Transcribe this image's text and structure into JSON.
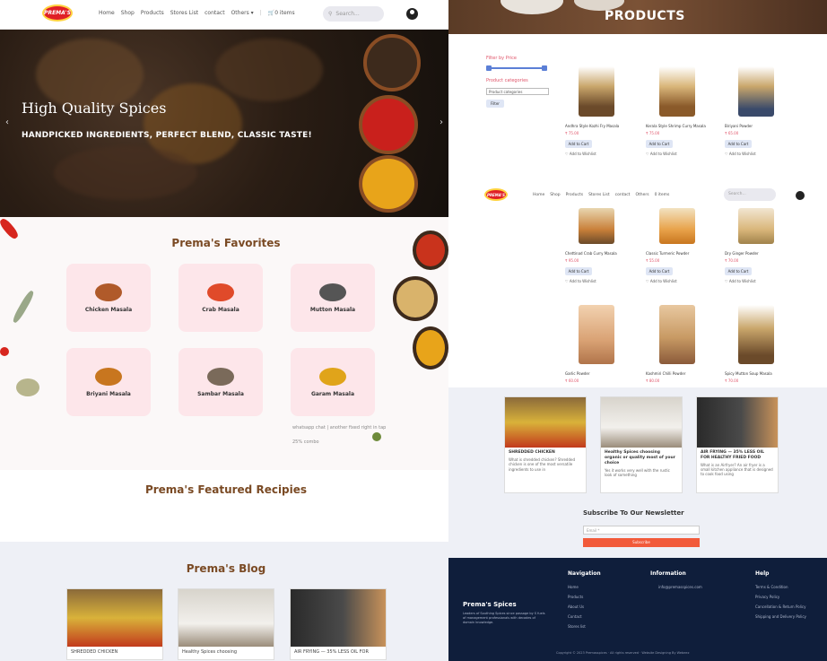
{
  "left": {
    "logo_text": "PREMA'S",
    "nav": {
      "items": [
        "Home",
        "Shop",
        "Products",
        "Stores List",
        "contact",
        "Others"
      ],
      "others_caret": "▾",
      "cart_label": "0 items",
      "search_placeholder": "Search..."
    },
    "hero": {
      "title": "High Quality Spices",
      "subtitle": "HANDPICKED INGREDIENTS, PERFECT BLEND, CLASSIC TASTE!"
    },
    "favorites": {
      "title": "Prema's Favorites",
      "items": [
        "Chicken Masala",
        "Crab Masala",
        "Mutton Masala",
        "Briyani Masala",
        "Sambar Masala",
        "Garam Masala"
      ]
    },
    "chat_lines": [
      "whatsapp chat | another fixed right in tap",
      "25% combo"
    ],
    "featured_title": "Prema's Featured Recipies",
    "blog": {
      "title": "Prema's Blog",
      "captions": [
        "SHREDDED CHICKEN",
        "Healthy Spices choosing",
        "AIR FRYING — 35% LESS OIL FOR"
      ]
    }
  },
  "right": {
    "banner_title": "PRODUCTS",
    "filter": {
      "price_label": "Filter by Price",
      "categories_label": "Product categories",
      "select_value": "Product categories",
      "button": "Filter"
    },
    "products_row1": [
      {
        "name": "Andhra Style Kozhi Fry Masala",
        "price": "₹ 75.00"
      },
      {
        "name": "Kerala Style Shrimp Curry Masala",
        "price": "₹ 75.00"
      },
      {
        "name": "Biriyani Powder",
        "price": "₹ 65.00"
      }
    ],
    "products_row2": [
      {
        "name": "Chettinad Crab Curry Masala",
        "price": "₹ 95.00"
      },
      {
        "name": "Classic Turmeric Powder",
        "price": "₹ 55.00"
      },
      {
        "name": "Dry Ginger Powder",
        "price": "₹ 70.00"
      }
    ],
    "products_row3": [
      {
        "name": "Garlic Powder",
        "price": "₹ 60.00"
      },
      {
        "name": "Kashmiri Chilli Powder",
        "price": "₹ 80.00"
      },
      {
        "name": "Spicy Mutton Soup Masala",
        "price": "₹ 70.00"
      }
    ],
    "add_to_cart": "Add to Cart",
    "wishlist": "Add to Wishlist",
    "nav2": {
      "logo_text": "PREMA'S",
      "items": [
        "Home",
        "Shop",
        "Products",
        "Stores List",
        "contact",
        "Others"
      ],
      "cart_label": "0 items",
      "search_placeholder": "Search..."
    },
    "blog": [
      {
        "title": "SHREDDED CHICKEN",
        "text": "What is shredded chicken? Shredded chicken is one of the most versatile ingredients to use in"
      },
      {
        "title": "Healthy Spices choosing organic or quality most of your choice",
        "text": "Yes it works very well with the rustic look of something"
      },
      {
        "title": "AIR FRYING — 35% LESS OIL FOR HEALTHY FRIED FOOD",
        "text": "What is an Airfryer? An air fryer is a small kitchen appliance that is designed to cook food using"
      }
    ],
    "newsletter": {
      "title": "Subscribe To Our Newsletter",
      "placeholder": "Email *",
      "button": "Subscribe"
    },
    "footer": {
      "brand": "Prema's Spices",
      "desc": "Leaders of Southing Spices since passage by S fuels of management professionals with decades of domain knowledge.",
      "nav_head": "Navigation",
      "nav_links": [
        "Home",
        "Products",
        "About Us",
        "Contact",
        "Stores list"
      ],
      "info_head": "Information",
      "info_email": "info@premasspices.com",
      "help_head": "Help",
      "help_links": [
        "Terms & Condition",
        "Privacy Policy",
        "Cancellation & Return Policy",
        "Shipping and Delivery Policy"
      ],
      "copyright": "Copyright © 2023 Premasspices · All rights reserved · Website Designing By Webeez"
    }
  }
}
